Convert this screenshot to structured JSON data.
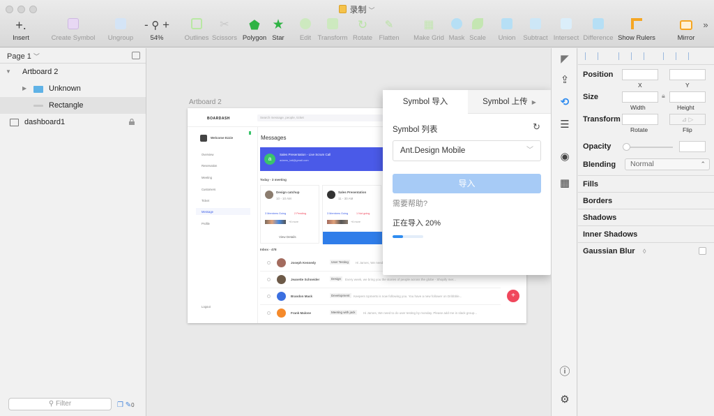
{
  "window": {
    "title": "录制"
  },
  "toolbar": {
    "insert": "Insert",
    "create_symbol": "Create Symbol",
    "ungroup": "Ungroup",
    "zoom": "54%",
    "outlines": "Outlines",
    "scissors": "Scissors",
    "polygon": "Polygon",
    "star": "Star",
    "edit": "Edit",
    "transform": "Transform",
    "rotate": "Rotate",
    "flatten": "Flatten",
    "make_grid": "Make Grid",
    "mask": "Mask",
    "scale": "Scale",
    "union": "Union",
    "subtract": "Subtract",
    "intersect": "Intersect",
    "difference": "Difference",
    "show_rulers": "Show Rulers",
    "mirror": "Mirror",
    "more": "»"
  },
  "layers": {
    "page": "Page 1",
    "items": [
      {
        "name": "Artboard 2"
      },
      {
        "name": "Unknown"
      },
      {
        "name": "Rectangle"
      },
      {
        "name": "dashboard1"
      }
    ],
    "filter_placeholder": "Filter",
    "filter_count": "0"
  },
  "canvas": {
    "artboard_label": "Artboard 2",
    "mockup": {
      "brand": "BOARDASH",
      "search": "Search message, people, ticket",
      "user": "Welcome Ezzie",
      "nav": [
        "Overview",
        "Reservation",
        "Meeting",
        "Customers",
        "Ticket",
        "Message",
        "Profile"
      ],
      "logout": "Logout",
      "messages_title": "Messages",
      "banner_title": "Sales Presentation - Live Scrum Call",
      "banner_email": "adams_tail@gmail.com",
      "banner_avatar": "a",
      "today": "Today - 3 meeting",
      "card1_title": "Design catchup",
      "card1_time": "10 - 10 AM",
      "card2_title": "Sales Presentation",
      "card2_time": "11 - 30 AM",
      "card_members": "3 Members Going",
      "card_pending": "2 Pending",
      "card2_pending": "1 Not going",
      "card_more": "+6 more",
      "view_details": "View Details",
      "inbox": "Inbox - 478",
      "rows": [
        {
          "name": "Joseph Kennedy",
          "tag": "User Testing",
          "preview": "Hi James, We need"
        },
        {
          "name": "Jeanette Schneider",
          "tag": "Design",
          "preview": "Every week, we bring you the stories of people across the globe - Shopify mer..."
        },
        {
          "name": "Brandon Mack",
          "tag": "Development",
          "preview": "Keepers Upmerts is now following you. You have a new follower on Dribbble..."
        },
        {
          "name": "Frank Malone",
          "tag": "Meeting with jack",
          "preview": "Hi James, We need to do user testing by monday. Please add me in slack group..."
        }
      ],
      "fab": "+"
    }
  },
  "plugin": {
    "tab_import": "Symbol 导入",
    "tab_upload": "Symbol 上传",
    "list_label": "Symbol 列表",
    "selected": "Ant.Design Mobile",
    "import_btn": "导入",
    "help": "需要帮助?",
    "status": "正在导入 20%",
    "progress": 0.2
  },
  "inspector": {
    "position": "Position",
    "x": "X",
    "y": "Y",
    "size": "Size",
    "width": "Width",
    "height": "Height",
    "transform": "Transform",
    "rotate": "Rotate",
    "flip": "Flip",
    "opacity": "Opacity",
    "blending": "Blending",
    "blending_value": "Normal",
    "fills": "Fills",
    "borders": "Borders",
    "shadows": "Shadows",
    "inner_shadows": "Inner Shadows",
    "gaussian_blur": "Gaussian Blur"
  },
  "colors": {
    "accent": "#2f8cf0",
    "import_btn": "#a7cbf6",
    "banner": "#4a5ae8",
    "fab": "#f0475c"
  }
}
